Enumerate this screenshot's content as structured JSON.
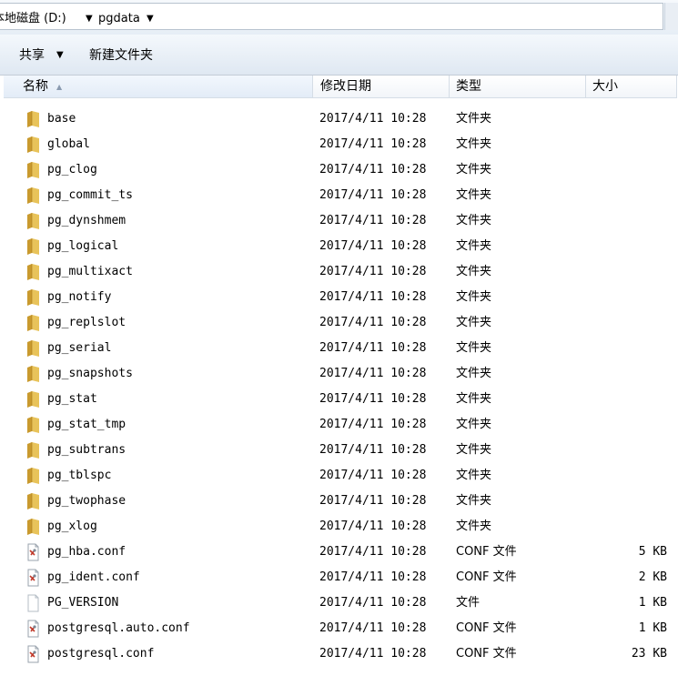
{
  "address": {
    "crumbs": [
      "本地磁盘 (D:)",
      "pgdata"
    ]
  },
  "toolbar": {
    "share_label": "共享",
    "new_folder_label": "新建文件夹"
  },
  "columns": {
    "name": "名称",
    "date": "修改日期",
    "type": "类型",
    "size": "大小"
  },
  "files": [
    {
      "name": "base",
      "date": "2017/4/11 10:28",
      "type": "文件夹",
      "size": "",
      "icon": "folder-icon"
    },
    {
      "name": "global",
      "date": "2017/4/11 10:28",
      "type": "文件夹",
      "size": "",
      "icon": "folder-icon"
    },
    {
      "name": "pg_clog",
      "date": "2017/4/11 10:28",
      "type": "文件夹",
      "size": "",
      "icon": "folder-icon"
    },
    {
      "name": "pg_commit_ts",
      "date": "2017/4/11 10:28",
      "type": "文件夹",
      "size": "",
      "icon": "folder-icon"
    },
    {
      "name": "pg_dynshmem",
      "date": "2017/4/11 10:28",
      "type": "文件夹",
      "size": "",
      "icon": "folder-icon"
    },
    {
      "name": "pg_logical",
      "date": "2017/4/11 10:28",
      "type": "文件夹",
      "size": "",
      "icon": "folder-icon"
    },
    {
      "name": "pg_multixact",
      "date": "2017/4/11 10:28",
      "type": "文件夹",
      "size": "",
      "icon": "folder-icon"
    },
    {
      "name": "pg_notify",
      "date": "2017/4/11 10:28",
      "type": "文件夹",
      "size": "",
      "icon": "folder-icon"
    },
    {
      "name": "pg_replslot",
      "date": "2017/4/11 10:28",
      "type": "文件夹",
      "size": "",
      "icon": "folder-icon"
    },
    {
      "name": "pg_serial",
      "date": "2017/4/11 10:28",
      "type": "文件夹",
      "size": "",
      "icon": "folder-icon"
    },
    {
      "name": "pg_snapshots",
      "date": "2017/4/11 10:28",
      "type": "文件夹",
      "size": "",
      "icon": "folder-icon"
    },
    {
      "name": "pg_stat",
      "date": "2017/4/11 10:28",
      "type": "文件夹",
      "size": "",
      "icon": "folder-icon"
    },
    {
      "name": "pg_stat_tmp",
      "date": "2017/4/11 10:28",
      "type": "文件夹",
      "size": "",
      "icon": "folder-icon"
    },
    {
      "name": "pg_subtrans",
      "date": "2017/4/11 10:28",
      "type": "文件夹",
      "size": "",
      "icon": "folder-icon"
    },
    {
      "name": "pg_tblspc",
      "date": "2017/4/11 10:28",
      "type": "文件夹",
      "size": "",
      "icon": "folder-icon"
    },
    {
      "name": "pg_twophase",
      "date": "2017/4/11 10:28",
      "type": "文件夹",
      "size": "",
      "icon": "folder-icon"
    },
    {
      "name": "pg_xlog",
      "date": "2017/4/11 10:28",
      "type": "文件夹",
      "size": "",
      "icon": "folder-icon"
    },
    {
      "name": "pg_hba.conf",
      "date": "2017/4/11 10:28",
      "type": "CONF 文件",
      "size": "5 KB",
      "icon": "conf-file-icon"
    },
    {
      "name": "pg_ident.conf",
      "date": "2017/4/11 10:28",
      "type": "CONF 文件",
      "size": "2 KB",
      "icon": "conf-file-icon"
    },
    {
      "name": "PG_VERSION",
      "date": "2017/4/11 10:28",
      "type": "文件",
      "size": "1 KB",
      "icon": "blank-file-icon"
    },
    {
      "name": "postgresql.auto.conf",
      "date": "2017/4/11 10:28",
      "type": "CONF 文件",
      "size": "1 KB",
      "icon": "conf-file-icon"
    },
    {
      "name": "postgresql.conf",
      "date": "2017/4/11 10:28",
      "type": "CONF 文件",
      "size": "23 KB",
      "icon": "conf-file-icon"
    }
  ],
  "colors": {
    "folder": "#e8c35a",
    "folder_dark": "#c99a2e",
    "header_border": "#d5dde6"
  }
}
